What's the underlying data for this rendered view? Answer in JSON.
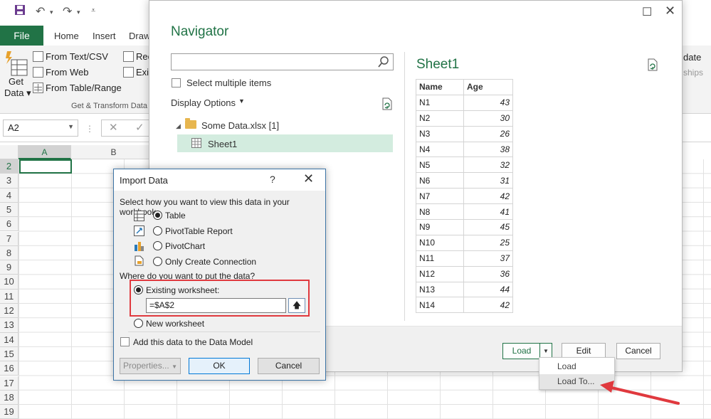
{
  "excel": {
    "ribbon_tabs": [
      "File",
      "Home",
      "Insert",
      "Draw"
    ],
    "get_transform": {
      "items": [
        "From Text/CSV",
        "From Web",
        "From Table/Range"
      ],
      "partial_items": [
        "Rec",
        "Exis"
      ],
      "get_data_label": "Get Data",
      "group_label": "Get & Transform Data"
    },
    "right_partial": [
      "date",
      "ships"
    ],
    "name_box": "A2",
    "columns": [
      "A",
      "B"
    ],
    "rows": [
      "2",
      "3",
      "4",
      "5",
      "6",
      "7",
      "8",
      "9",
      "10",
      "11",
      "12",
      "13",
      "14",
      "15",
      "16",
      "17",
      "18",
      "19"
    ],
    "accent": "#217346"
  },
  "navigator": {
    "title": "Navigator",
    "search": {
      "placeholder": ""
    },
    "select_multiple": "Select multiple items",
    "display_options": "Display Options",
    "tree": {
      "file": "Some Data.xlsx [1]",
      "sheet": "Sheet1"
    },
    "preview": {
      "title": "Sheet1",
      "columns": [
        "Name",
        "Age"
      ],
      "rows": [
        [
          "N1",
          "43"
        ],
        [
          "N2",
          "30"
        ],
        [
          "N3",
          "26"
        ],
        [
          "N4",
          "38"
        ],
        [
          "N5",
          "32"
        ],
        [
          "N6",
          "31"
        ],
        [
          "N7",
          "42"
        ],
        [
          "N8",
          "41"
        ],
        [
          "N9",
          "45"
        ],
        [
          "N10",
          "25"
        ],
        [
          "N11",
          "37"
        ],
        [
          "N12",
          "36"
        ],
        [
          "N13",
          "44"
        ],
        [
          "N14",
          "42"
        ]
      ]
    },
    "buttons": {
      "load": "Load",
      "edit": "Edit",
      "cancel": "Cancel"
    },
    "load_menu": [
      "Load",
      "Load To..."
    ]
  },
  "import_dialog": {
    "title": "Import Data",
    "help": "?",
    "view_prompt": "Select how you want to view this data in your workbook.",
    "view_options": [
      "Table",
      "PivotTable Report",
      "PivotChart",
      "Only Create Connection"
    ],
    "view_selected": "Table",
    "put_prompt": "Where do you want to put the data?",
    "existing_label": "Existing worksheet:",
    "existing_value": "=$A$2",
    "new_label": "New worksheet",
    "data_model_label": "Add this data to the Data Model",
    "buttons": {
      "properties": "Properties...",
      "ok": "OK",
      "cancel": "Cancel"
    },
    "highlight_color": "#e0393e"
  }
}
